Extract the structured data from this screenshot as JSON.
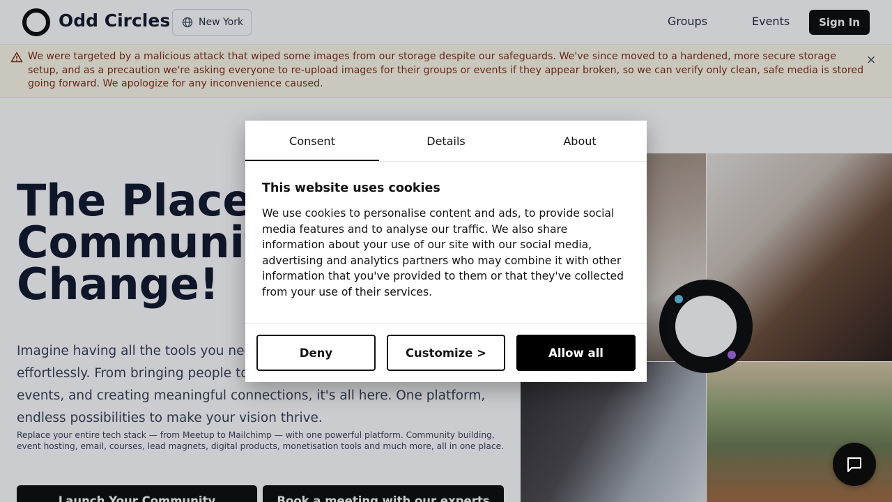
{
  "header": {
    "brand": "Odd Circles",
    "location": "New York",
    "nav": [
      "Groups",
      "Events"
    ],
    "signin": "Sign In"
  },
  "alert": {
    "text": "We were targeted by a malicious attack that wiped some images from our storage despite our safeguards. We've since moved to a hardened, more secure storage setup, and as a precaution we're asking everyone to re-upload images for their groups or events if they appear broken, so we can verify only clean, safe media is stored going forward. We apologize for any inconvenience caused.",
    "close": "×"
  },
  "hero": {
    "title_lines": [
      "The Place",
      "Communit",
      "Change!"
    ],
    "description": "Imagine having all the tools you need to build a thriving community—effortlessly. From bringing people together, sharing knowledge, hosting events, and creating meaningful connections, it's all here. One platform, endless possibilities to make your vision thrive.",
    "small": "Replace your entire tech stack — from Meetup to Mailchimp — with one powerful platform. Community building, event hosting, email, courses, lead magnets, digital products, monetisation tools and much more, all in one place.",
    "cta_primary": "Launch Your Community",
    "cta_secondary": "Book a meeting with our experts"
  },
  "cookie": {
    "tabs": [
      "Consent",
      "Details",
      "About"
    ],
    "active_tab": "Consent",
    "title": "This website uses cookies",
    "body": "We use cookies to personalise content and ads, to provide social media features and to analyse our traffic. We also share information about your use of our site with our social media, advertising and analytics partners who may combine it with other information that you've provided to them or that they've collected from your use of their services.",
    "deny": "Deny",
    "customize": "Customize >",
    "allow": "Allow all"
  },
  "colors": {
    "brand_dark": "#0b0b0b",
    "alert_bg": "#fef9e7",
    "alert_text": "#7c2d12"
  }
}
